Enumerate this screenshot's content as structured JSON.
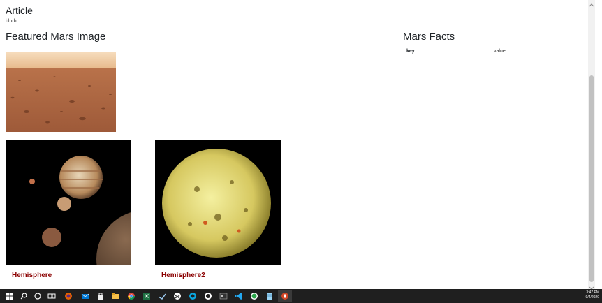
{
  "article": {
    "title": "Article",
    "blurb": "blurb"
  },
  "featured": {
    "title": "Featured Mars Image"
  },
  "facts": {
    "title": "Mars Facts",
    "header_key": "key",
    "header_value": "value"
  },
  "hemispheres": [
    {
      "title": "Hemisphere"
    },
    {
      "title": "Hemisphere2"
    }
  ],
  "taskbar": {
    "time": "3:47 PM",
    "date": "9/4/2020",
    "icons": [
      "windows-start-icon",
      "search-icon",
      "cortana-icon",
      "task-view-icon",
      "firefox-icon",
      "mail-icon",
      "store-icon",
      "file-explorer-icon",
      "excel-icon",
      "chrome-icon",
      "steam-icon",
      "edge-icon",
      "xbox-icon",
      "github-icon",
      "terminal-icon",
      "vscode-icon",
      "spotify-icon",
      "notepad-icon",
      "powerpoint-icon"
    ]
  },
  "colors": {
    "hemisphere_link": "#8b0000",
    "taskbar_bg": "#1f1f1f"
  }
}
